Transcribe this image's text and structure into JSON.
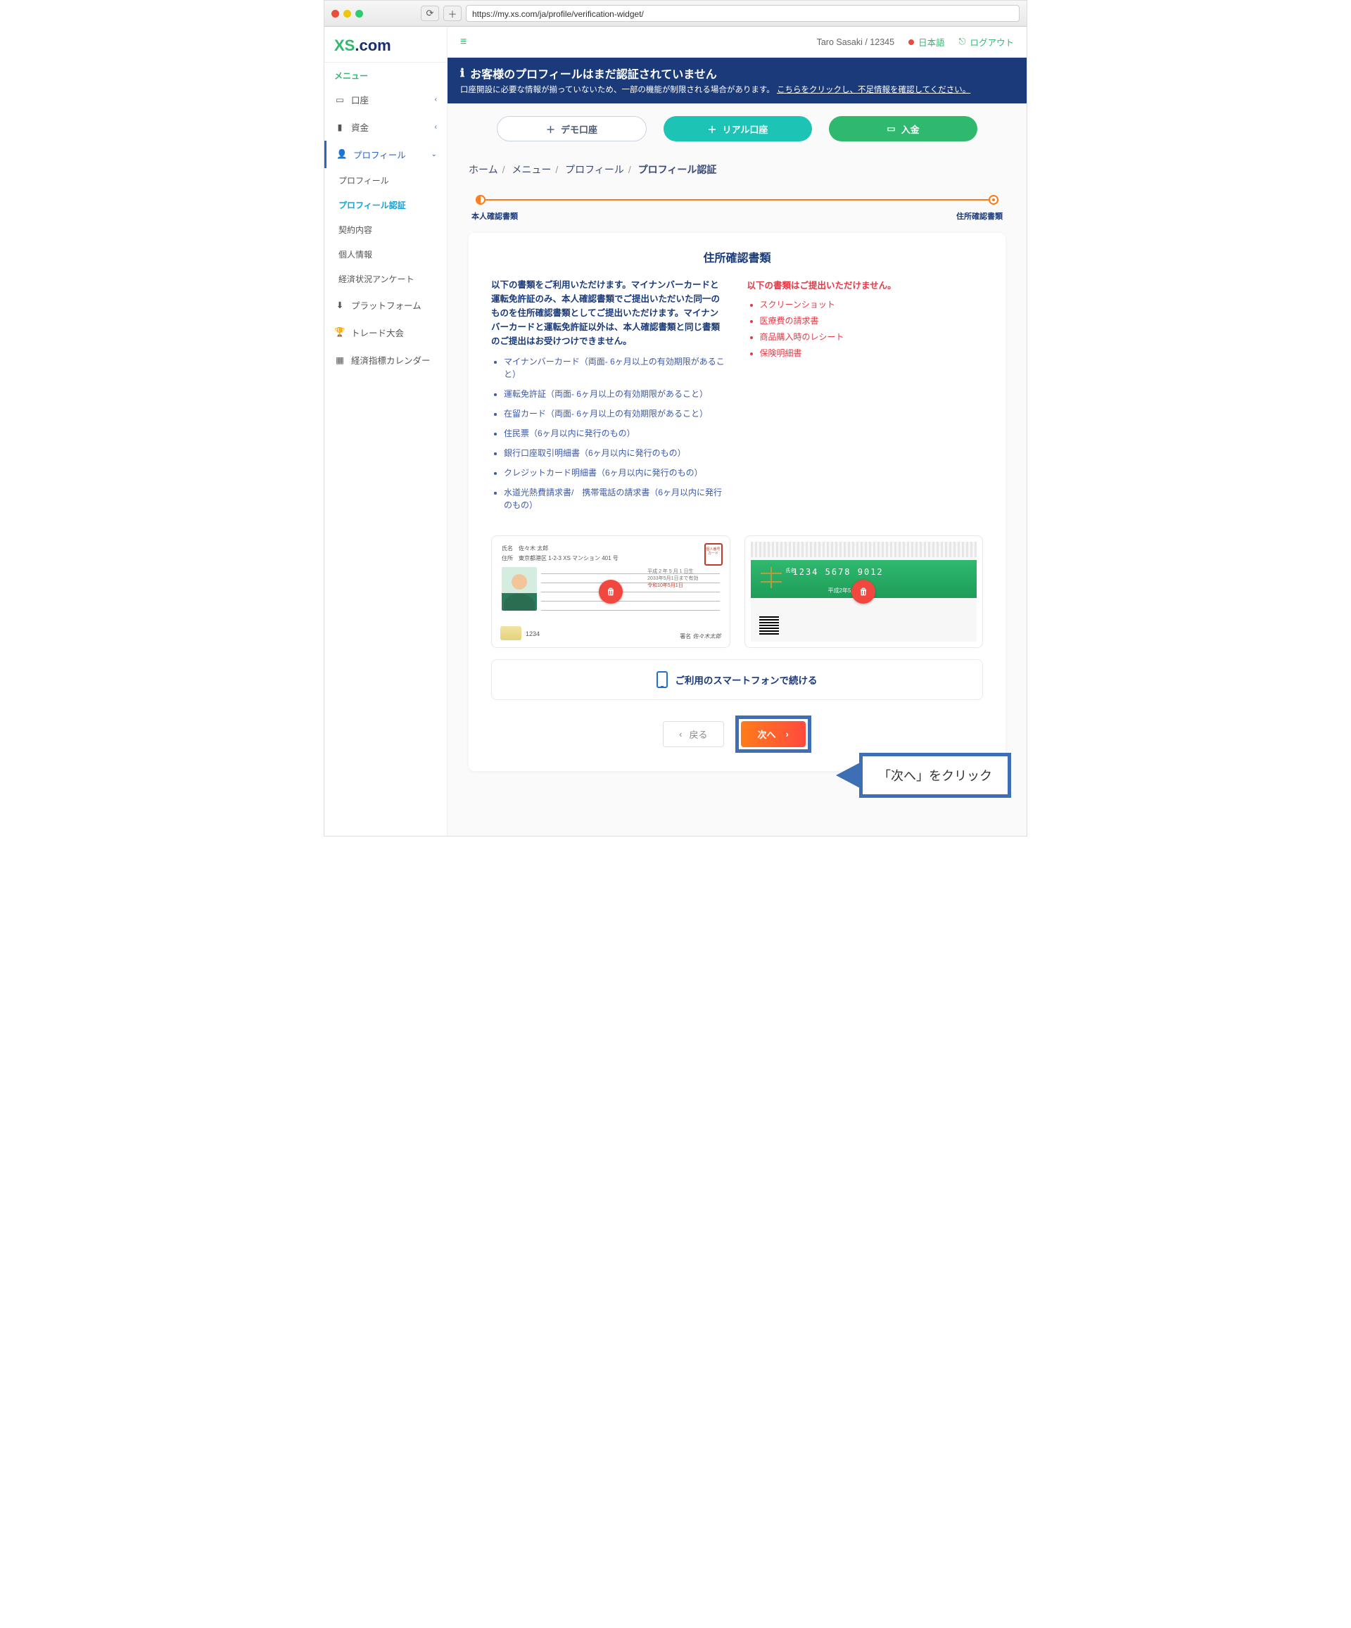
{
  "browser": {
    "url": "https://my.xs.com/ja/profile/verification-widget/"
  },
  "logo": {
    "xs": "XS",
    "dot": ".com"
  },
  "menu_label": "メニュー",
  "nav": {
    "account": "口座",
    "funds": "資金",
    "profile": "プロフィール",
    "sub_profile": "プロフィール",
    "sub_verification": "プロフィール認証",
    "sub_contract": "契約内容",
    "sub_personal": "個人情報",
    "sub_econ": "経済状況アンケート",
    "platform": "プラットフォーム",
    "trade": "トレード大会",
    "calendar": "経済指標カレンダー"
  },
  "topbar": {
    "user": "Taro Sasaki / 12345",
    "lang": "日本語",
    "signout": "ログアウト"
  },
  "notice": {
    "title": "お客様のプロフィールはまだ認証されていません",
    "sub": "口座開設に必要な情報が揃っていないため、一部の機能が制限される場合があります。 ",
    "link": "こちらをクリックし、不足情報を確認してください。"
  },
  "buttons": {
    "demo": "デモ口座",
    "real": "リアル口座",
    "deposit": "入金"
  },
  "breadcrumb": {
    "home": "ホーム",
    "menu": "メニュー",
    "profile": "プロフィール",
    "current": "プロフィール認証"
  },
  "stepper": {
    "step1": "本人確認書類",
    "step2": "住所確認書類"
  },
  "card": {
    "title": "住所確認書類",
    "ok_head": "以下の書類をご利用いただけます。マイナンバーカードと運転免許証のみ、本人確認書類でご提出いただいた同一のものを住所確認書類としてご提出いただけます。マイナンバーカードと運転免許証以外は、本人確認書類と同じ書類のご提出はお受けつけできません。",
    "ok_items": [
      "マイナンバーカード（両面- 6ヶ月以上の有効期限があること）",
      "運転免許証（両面- 6ヶ月以上の有効期限があること）",
      "在留カード（両面- 6ヶ月以上の有効期限があること）",
      "住民票（6ヶ月以内に発行のもの）",
      "銀行口座取引明細書（6ヶ月以内に発行のもの）",
      "クレジットカード明細書（6ヶ月以内に発行のもの）",
      "水道光熱費請求書/　携帯電話の請求書（6ヶ月以内に発行のもの）"
    ],
    "ng_head": "以下の書類はご提出いただけません。",
    "ng_items": [
      "スクリーンショット",
      "医療費の請求書",
      "商品購入時のレシート",
      "保険明細書"
    ]
  },
  "id_front": {
    "name_lbl": "氏名",
    "name": "佐々木 太郎",
    "addr_lbl": "住所",
    "addr": "東京都港区 1-2-3 XS マンション 401 号",
    "era1": "平成 2 年 5 月 1 日生",
    "exp": "2033年5月1日まで有効",
    "reiwa": "令和10年5月1日",
    "num": "1234",
    "sign_lbl": "署名",
    "sign": "佐々木太郎",
    "stamp": "個人番号\nカード"
  },
  "id_back": {
    "num": "1234  5678  9012",
    "name_lbl": "氏名",
    "dob": "平成2年5月1日生"
  },
  "smartphone": "ご利用のスマートフォンで続ける",
  "nav_btns": {
    "back": "戻る",
    "next": "次へ"
  },
  "callout": "「次へ」をクリック"
}
